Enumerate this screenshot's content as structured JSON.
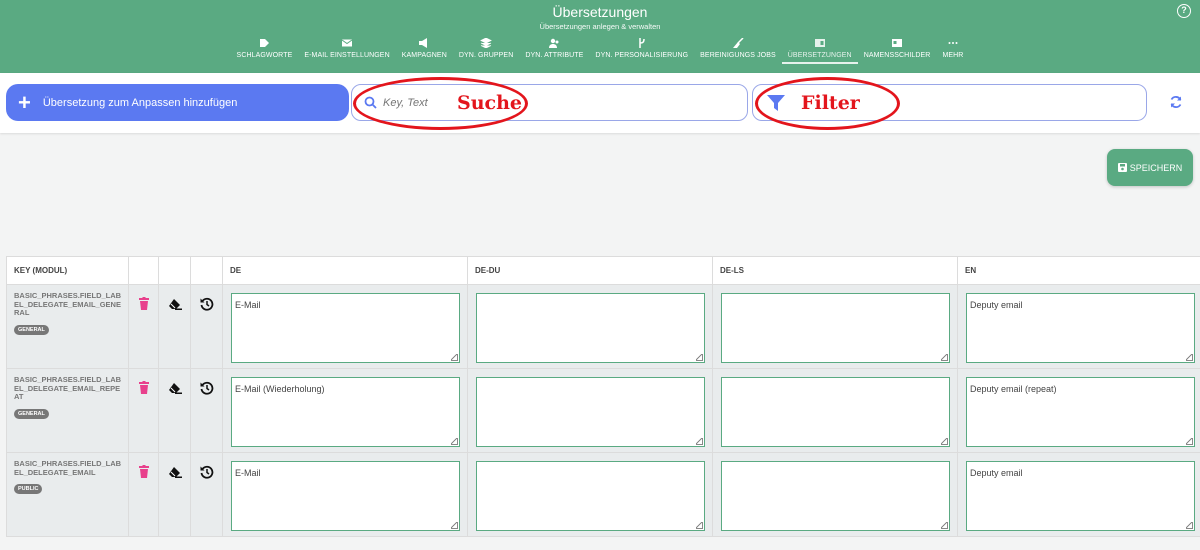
{
  "header": {
    "title": "Übersetzungen",
    "subtitle": "Übersetzungen anlegen & verwalten",
    "help_label": "?",
    "nav": [
      {
        "label": "SCHLAGWORTE",
        "icon": "tag-icon"
      },
      {
        "label": "E-MAIL EINSTELLUNGEN",
        "icon": "envelope-icon"
      },
      {
        "label": "KAMPAGNEN",
        "icon": "megaphone-icon"
      },
      {
        "label": "DYN. GRUPPEN",
        "icon": "layers-icon"
      },
      {
        "label": "DYN. ATTRIBUTE",
        "icon": "users-icon"
      },
      {
        "label": "DYN. PERSONALISIERUNG",
        "icon": "branch-icon"
      },
      {
        "label": "BEREINIGUNGS JOBS",
        "icon": "broom-icon"
      },
      {
        "label": "ÜBERSETZUNGEN",
        "icon": "translate-icon",
        "active": true
      },
      {
        "label": "NAMENSSCHILDER",
        "icon": "nametag-icon"
      },
      {
        "label": "MEHR",
        "icon": "more-icon"
      }
    ]
  },
  "toolbar": {
    "add_label": "Übersetzung zum Anpassen hinzufügen",
    "search_placeholder": "Key, Text",
    "search_annotation": "Suche",
    "filter_annotation": "Filter"
  },
  "save_label": "SPEICHERN",
  "table": {
    "headers": [
      "KEY (MODUL)",
      "",
      "",
      "",
      "DE",
      "DE-DU",
      "DE-LS",
      "EN"
    ],
    "rows": [
      {
        "key": "BASIC_PHRASES.FIELD_LABEL_DELEGATE_EMAIL_GENERAL",
        "module": "GENERAL",
        "de": "E-Mail",
        "de_du": "",
        "de_ls": "",
        "en": "Deputy email"
      },
      {
        "key": "BASIC_PHRASES.FIELD_LABEL_DELEGATE_EMAIL_REPEAT",
        "module": "GENERAL",
        "de": "E-Mail (Wiederholung)",
        "de_du": "",
        "de_ls": "",
        "en": "Deputy email (repeat)"
      },
      {
        "key": "BASIC_PHRASES.FIELD_LABEL_DELEGATE_EMAIL",
        "module": "PUBLIC",
        "de": "E-Mail",
        "de_du": "",
        "de_ls": "",
        "en": "Deputy email"
      }
    ]
  },
  "colors": {
    "accent": "#5aaa82",
    "primary": "#5b79f1",
    "delete": "#e8408c",
    "annotation": "#e3151c"
  }
}
